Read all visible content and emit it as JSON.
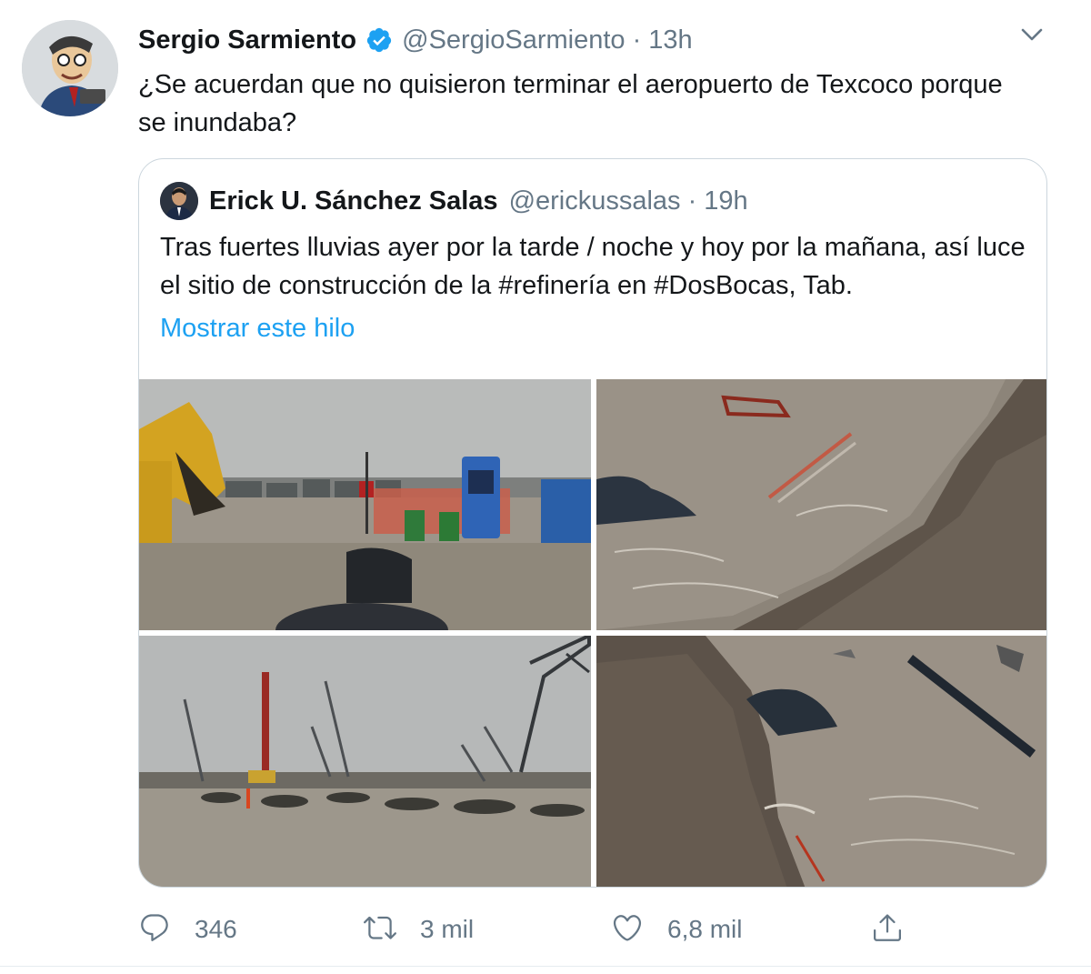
{
  "tweet": {
    "author_name": "Sergio Sarmiento",
    "author_handle": "@SergioSarmiento",
    "separator": "·",
    "time": "13h",
    "text": "¿Se acuerdan que no quisieron terminar el aeropuerto de Texcoco porque se inundaba?",
    "verified": true
  },
  "quoted": {
    "author_name": "Erick U. Sánchez Salas",
    "author_handle": "@erickussalas",
    "separator": "·",
    "time": "19h",
    "text": "Tras fuertes lluvias ayer por la tarde / noche y hoy por la mañana, así luce el sitio de construcción de la #refinería en #DosBocas, Tab.",
    "show_thread": "Mostrar este hilo",
    "photos": [
      {
        "name": "flooded-site-excavator-photo"
      },
      {
        "name": "flooded-water-debris-photo"
      },
      {
        "name": "flooded-cranes-photo"
      },
      {
        "name": "flooded-earth-bank-photo"
      }
    ]
  },
  "actions": {
    "replies": "346",
    "retweets": "3 mil",
    "likes": "6,8 mil"
  },
  "colors": {
    "accent": "#1da1f2",
    "text": "#14171a",
    "muted": "#657786",
    "border": "#ccd6dd"
  },
  "icons": {
    "verified": "verified-badge-icon",
    "menu": "chevron-down-icon",
    "reply": "reply-icon",
    "retweet": "retweet-icon",
    "like": "heart-icon",
    "share": "share-icon"
  }
}
